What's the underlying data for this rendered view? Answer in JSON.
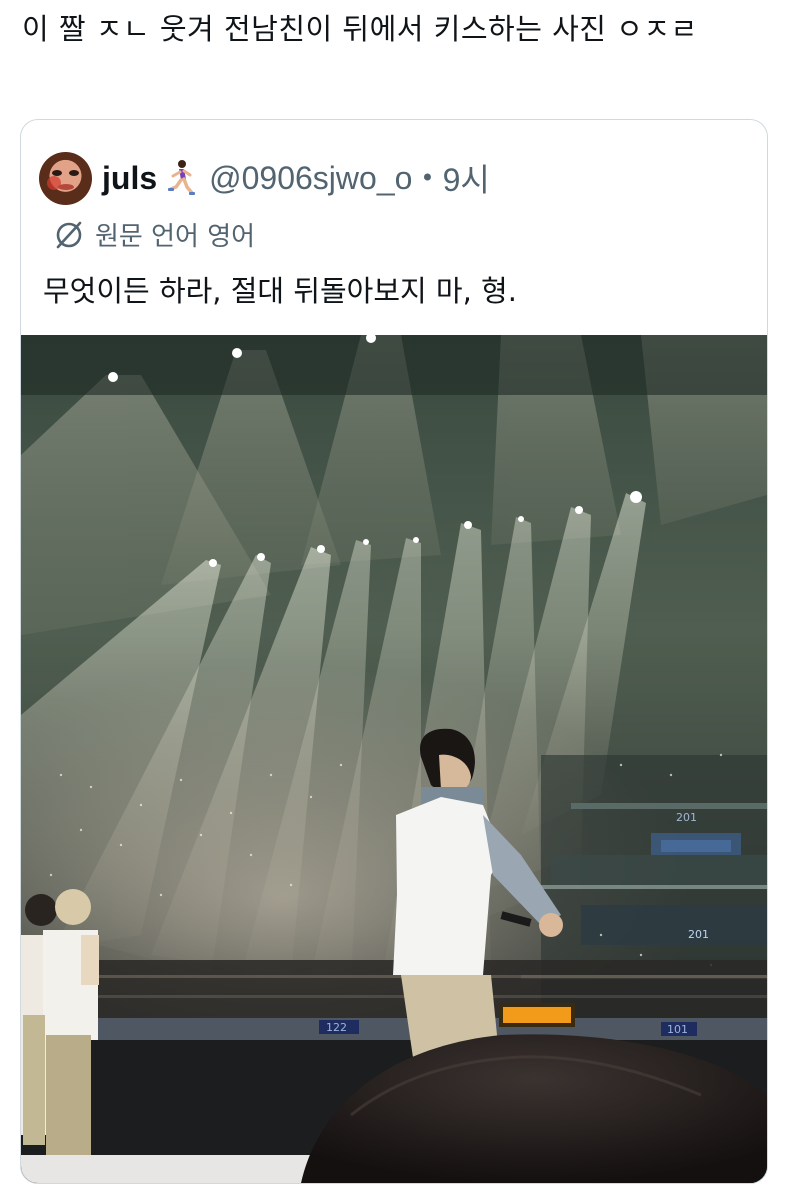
{
  "post": {
    "text": "이 짤 ㅈㄴ 웃겨 전남친이 뒤에서 키스하는 사진 ㅇㅈㄹ"
  },
  "quote": {
    "author_name": "juls",
    "author_handle": "@0906sjwo_o",
    "separator": "•",
    "time": "9시",
    "translate_label": "원문 언어 영어",
    "text": "무엇이든 하라, 절대 뒤돌아보지 마, 형."
  },
  "media": {
    "signs": {
      "s201_upper": "201",
      "s201_lower": "201",
      "s122": "122",
      "s101": "101",
      "overhead": "201"
    }
  },
  "icons": {
    "emoji": "running-woman-emoji",
    "translate": "globe-slash-icon"
  },
  "colors": {
    "text": "#0f1419",
    "secondary": "#536471",
    "border": "#cfd9de"
  }
}
